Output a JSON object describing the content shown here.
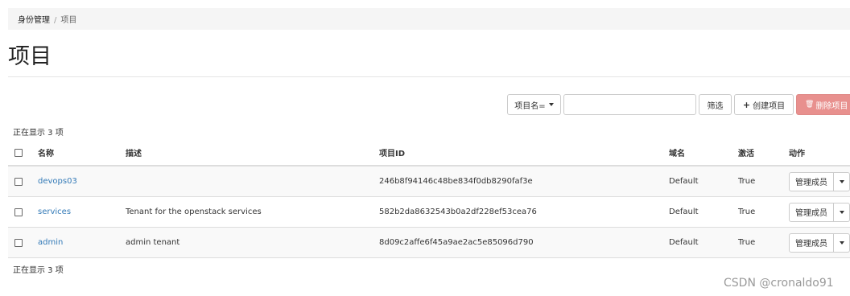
{
  "breadcrumb": {
    "items": [
      "身份管理",
      "项目"
    ],
    "separator": "/"
  },
  "page": {
    "title": "项目"
  },
  "toolbar": {
    "filter_field": "项目名=",
    "filter_value": "",
    "filter_button": "筛选",
    "create_button": "创建项目",
    "delete_button": "删除项目"
  },
  "table": {
    "count_text": "正在显示 3 项",
    "columns": [
      "名称",
      "描述",
      "项目ID",
      "域名",
      "激活",
      "动作"
    ],
    "rows": [
      {
        "name": "devops03",
        "description": "",
        "id": "246b8f94146c48be834f0db8290faf3e",
        "domain": "Default",
        "enabled": "True",
        "action": "管理成员"
      },
      {
        "name": "services",
        "description": "Tenant for the openstack services",
        "id": "582b2da8632543b0a2df228ef53cea76",
        "domain": "Default",
        "enabled": "True",
        "action": "管理成员"
      },
      {
        "name": "admin",
        "description": "admin tenant",
        "id": "8d09c2affe6f45a9ae2ac5e85096d790",
        "domain": "Default",
        "enabled": "True",
        "action": "管理成员"
      }
    ]
  },
  "watermark": "CSDN @cronaldo91",
  "colors": {
    "link": "#337ab7",
    "danger": "#e8908e",
    "breadcrumb_bg": "#f5f5f5"
  }
}
